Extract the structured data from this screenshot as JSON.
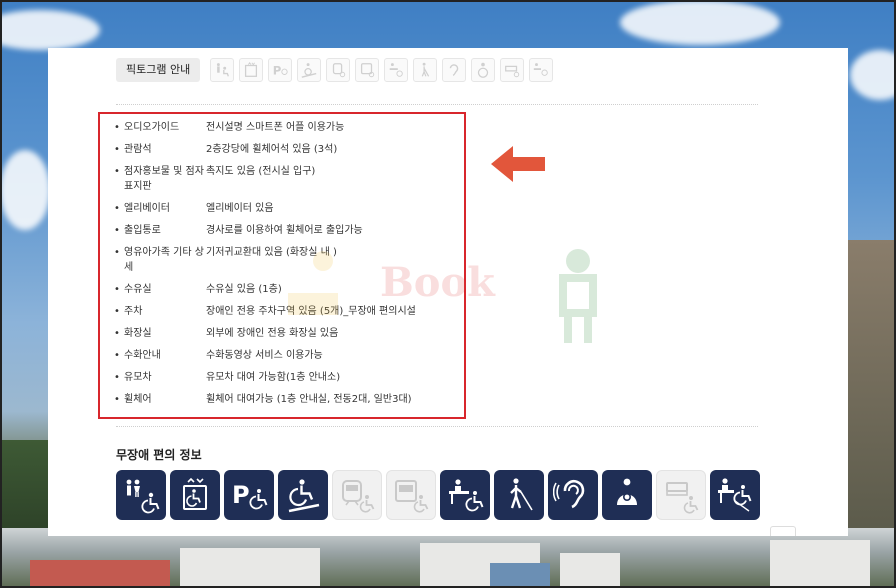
{
  "tabs": {
    "active_label": "픽토그램 안내",
    "icons": [
      "accessible-toilet-icon",
      "elevator-icon",
      "accessible-parking-icon",
      "ramp-icon",
      "rail-access-icon",
      "bus-access-icon",
      "information-desk-icon",
      "blind-guide-icon",
      "hearing-icon",
      "nursing-room-icon",
      "accessible-room-icon",
      "wheelchair-rental-icon"
    ]
  },
  "info": {
    "items": [
      {
        "label": "오디오가이드",
        "value": "전시설명 스마트폰 어플 이용가능"
      },
      {
        "label": "관람석",
        "value": "2층강당에 휠체어석 있음 (3석)"
      },
      {
        "label": "점자홍보물 및 점자표지판",
        "value": "촉지도 있음 (전시실 입구)"
      },
      {
        "label": "엘리베이터",
        "value": "엘리베이터 있음"
      },
      {
        "label": "출입통로",
        "value": "경사로를 이용하여 휠체어로 출입가능"
      },
      {
        "label": "영유아가족 기타 상세",
        "value": "기저귀교환대 있음 (화장실 내 )"
      },
      {
        "label": "수유실",
        "value": "수유실 있음 (1층)"
      },
      {
        "label": "주차",
        "value": "장애인 전용 주차구역 있음 (5개)_무장애 편의시설"
      },
      {
        "label": "화장실",
        "value": "외부에 장애인 전용 화장실 있음"
      },
      {
        "label": "수화안내",
        "value": "수화동영상 서비스 이용가능"
      },
      {
        "label": "유모차",
        "value": "유모차 대여 가능함(1층 안내소)"
      },
      {
        "label": "휠체어",
        "value": "휠체어 대여가능 (1층 안내실, 전동2대, 일반3대)"
      }
    ],
    "bullet": "•"
  },
  "watermark": {
    "text": "Book"
  },
  "accessibility": {
    "title": "무장애 편의 정보",
    "icons": [
      {
        "name": "accessible-toilet-icon",
        "active": true
      },
      {
        "name": "elevator-icon",
        "active": true
      },
      {
        "name": "accessible-parking-icon",
        "active": true
      },
      {
        "name": "ramp-icon",
        "active": true
      },
      {
        "name": "rail-access-icon",
        "active": false
      },
      {
        "name": "bus-access-icon",
        "active": false
      },
      {
        "name": "information-desk-icon",
        "active": true
      },
      {
        "name": "blind-guide-icon",
        "active": true
      },
      {
        "name": "hearing-icon",
        "active": true
      },
      {
        "name": "nursing-room-icon",
        "active": true
      },
      {
        "name": "accessible-room-icon",
        "active": false
      },
      {
        "name": "wheelchair-rental-icon",
        "active": true
      }
    ]
  },
  "colors": {
    "navy": "#1f2e55",
    "highlight_red": "#d8262c",
    "arrow_orange": "#e2563b"
  }
}
